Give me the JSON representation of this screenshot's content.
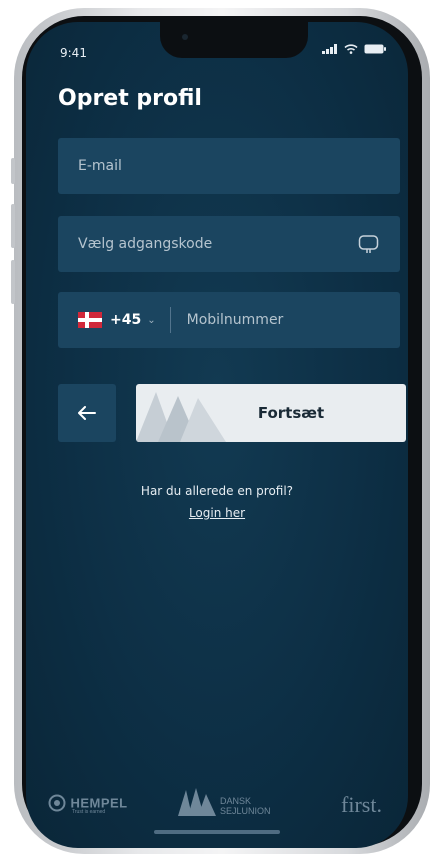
{
  "status_bar": {
    "time": "9:41"
  },
  "page": {
    "title": "Opret profil"
  },
  "form": {
    "email_placeholder": "E-mail",
    "password_placeholder": "Vælg adgangskode",
    "country_code": "+45",
    "phone_placeholder": "Mobilnummer"
  },
  "actions": {
    "continue_label": "Fortsæt"
  },
  "login_prompt": {
    "question": "Har du allerede en profil?",
    "link": "Login her"
  },
  "sponsors": {
    "hempel": "HEMPEL",
    "hempel_tagline": "Trust is earned",
    "dansk_line1": "DANSK",
    "dansk_line2": "SEJLUNION",
    "first": "first."
  },
  "colors": {
    "background": "#0d2f45",
    "field": "#1b4560",
    "button": "#e9edf0"
  }
}
